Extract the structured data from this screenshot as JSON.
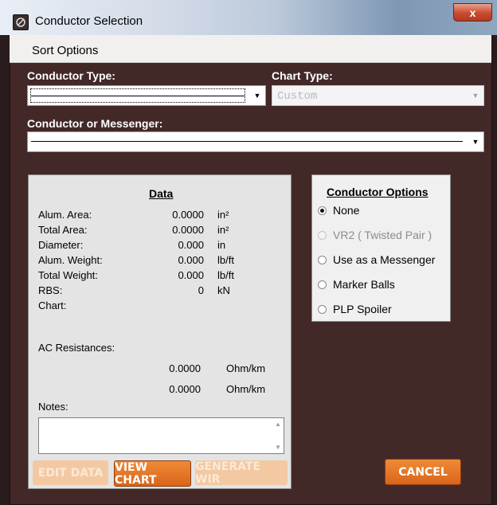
{
  "window": {
    "title": "Conductor Selection",
    "close_glyph": "x"
  },
  "menu": {
    "items": [
      "Sort Options"
    ]
  },
  "labels": {
    "conductor_type": "Conductor Type:",
    "chart_type": "Chart Type:",
    "conductor_or_messenger": "Conductor or Messenger:"
  },
  "chart_type_value": "Custom",
  "data_panel": {
    "title": "Data",
    "rows": [
      {
        "label": "Alum. Area:",
        "value": "0.0000",
        "unit": "in²"
      },
      {
        "label": "Total Area:",
        "value": "0.0000",
        "unit": "in²"
      },
      {
        "label": "Diameter:",
        "value": "0.000",
        "unit": "in"
      },
      {
        "label": "Alum. Weight:",
        "value": "0.000",
        "unit": "lb/ft"
      },
      {
        "label": "Total Weight:",
        "value": "0.000",
        "unit": "lb/ft"
      },
      {
        "label": "RBS:",
        "value": "0",
        "unit": "kN"
      },
      {
        "label": "Chart:",
        "value": "",
        "unit": ""
      }
    ],
    "ac_resistances_label": "AC Resistances:",
    "ac_resistances": [
      {
        "value": "0.0000",
        "unit": "Ohm/km"
      },
      {
        "value": "0.0000",
        "unit": "Ohm/km"
      }
    ],
    "notes_label": "Notes:"
  },
  "buttons": {
    "edit_data": "EDIT DATA",
    "view_chart": "VIEW CHART",
    "generate_wir": "GENERATE WIR",
    "cancel": "CANCEL"
  },
  "conductor_options": {
    "title": "Conductor Options",
    "options": [
      {
        "label": "None",
        "checked": true,
        "enabled": true
      },
      {
        "label": "VR2 ( Twisted Pair )",
        "checked": false,
        "enabled": false
      },
      {
        "label": "Use as a Messenger",
        "checked": false,
        "enabled": true
      },
      {
        "label": "Marker Balls",
        "checked": false,
        "enabled": true
      },
      {
        "label": "PLP Spoiler",
        "checked": false,
        "enabled": true
      }
    ]
  },
  "colors": {
    "background": "#432828",
    "button_orange": "#e2701f",
    "button_disabled": "#f2c9a2"
  }
}
